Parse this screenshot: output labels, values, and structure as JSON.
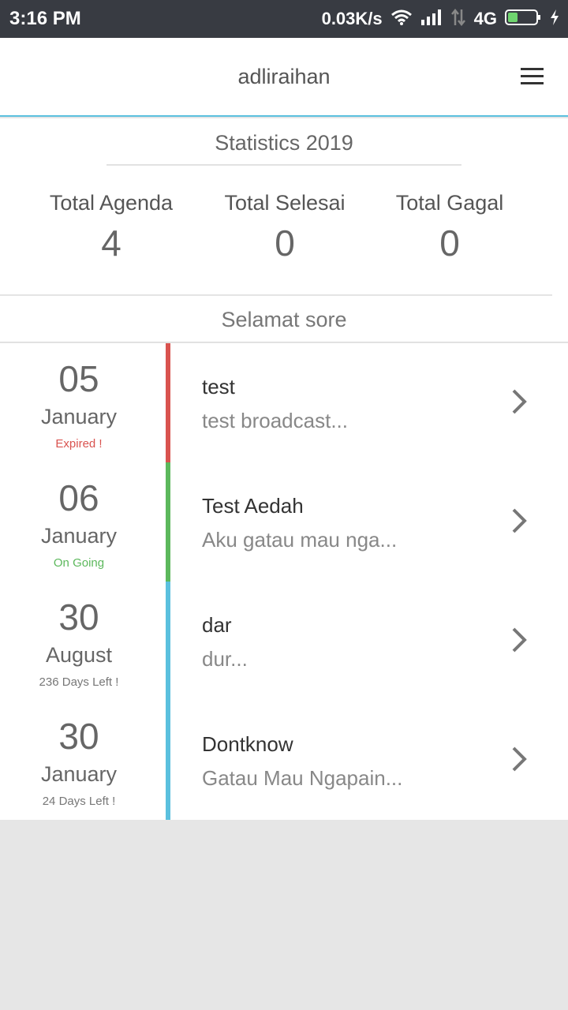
{
  "status_bar": {
    "time": "3:16 PM",
    "speed": "0.03K/s",
    "network": "4G",
    "battery_level": 0.35,
    "icons": [
      "wifi-icon",
      "signal-icon",
      "data-arrows-icon",
      "battery-icon",
      "charging-icon"
    ]
  },
  "header": {
    "title": "adliraihan",
    "menu_icon": "hamburger-menu-icon"
  },
  "stats": {
    "title": "Statistics 2019",
    "items": [
      {
        "label": "Total Agenda",
        "value": "4"
      },
      {
        "label": "Total Selesai",
        "value": "0"
      },
      {
        "label": "Total Gagal",
        "value": "0"
      }
    ],
    "greeting": "Selamat sore"
  },
  "agenda": [
    {
      "day": "05",
      "month": "January",
      "status": "Expired !",
      "status_color": "#d9534f",
      "bar_color": "#d9534f",
      "title": "test",
      "desc": "test broadcast..."
    },
    {
      "day": "06",
      "month": "January",
      "status": "On Going",
      "status_color": "#5cb85c",
      "bar_color": "#5cb85c",
      "title": "Test Aedah",
      "desc": "Aku gatau mau nga..."
    },
    {
      "day": "30",
      "month": "August",
      "status": "236 Days Left !",
      "status_color": "#777777",
      "bar_color": "#5bc0de",
      "title": "dar",
      "desc": "dur..."
    },
    {
      "day": "30",
      "month": "January",
      "status": "24 Days Left !",
      "status_color": "#777777",
      "bar_color": "#5bc0de",
      "title": "Dontknow",
      "desc": "Gatau Mau Ngapain..."
    }
  ],
  "colors": {
    "accent": "#5bc0de",
    "status_bar_bg": "#383b42",
    "page_bg": "#e6e6e6"
  }
}
